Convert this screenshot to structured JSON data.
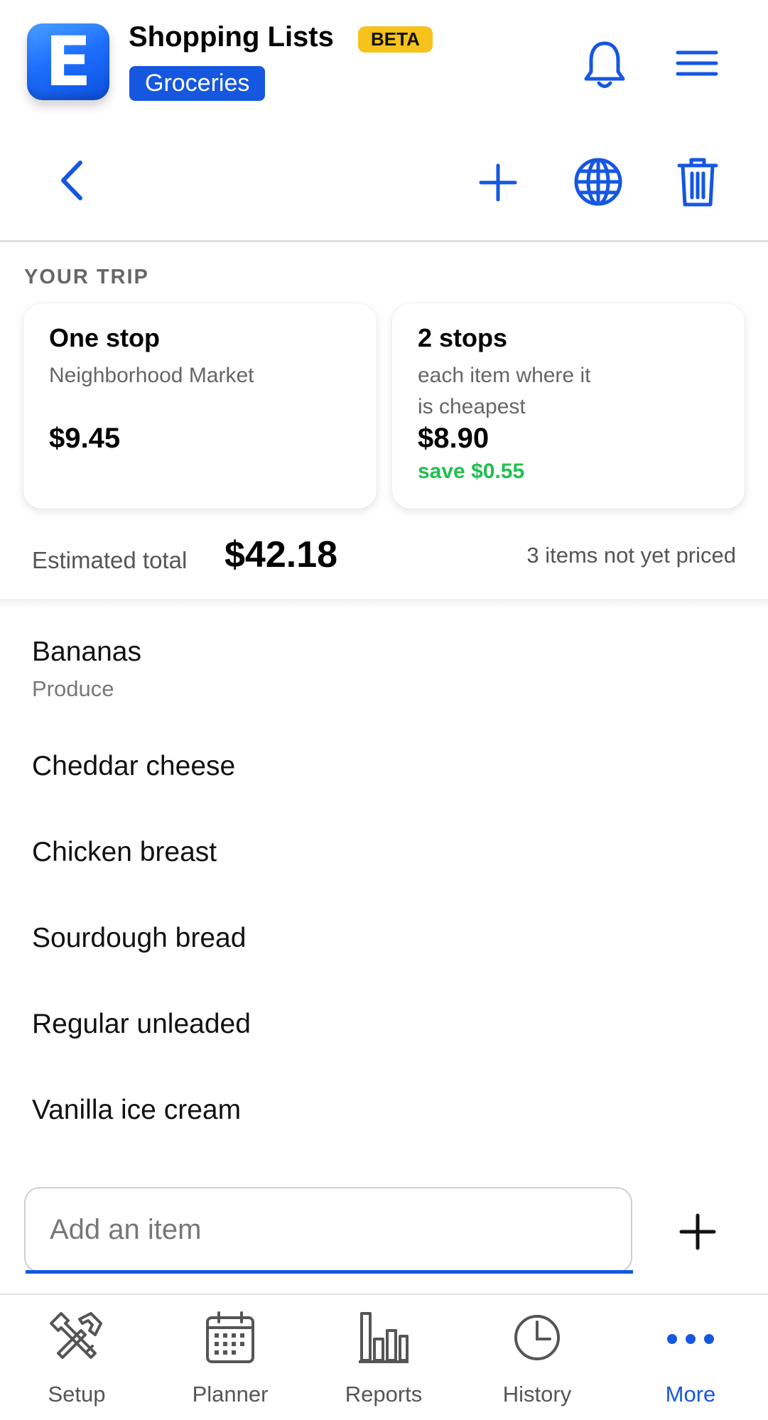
{
  "header": {
    "logo_letter": "E",
    "app_title": "Shopping Lists",
    "badge": "BETA",
    "list_name": "Groceries"
  },
  "toolbar": {
    "icons": [
      "back-icon",
      "add-icon",
      "globe-icon",
      "trash-icon"
    ]
  },
  "trip": {
    "section_label": "YOUR TRIP",
    "one_stop": {
      "title": "One stop",
      "subtitle": "Neighborhood Market",
      "price": "$9.45"
    },
    "two_stops": {
      "title": "2 stops",
      "subtitle_line1": "each item where it",
      "subtitle_line2": "is cheapest",
      "price": "$8.90",
      "savings": "save $0.55"
    },
    "estimated_label": "Estimated total",
    "estimated_value": "$42.18",
    "unpriced_note": "3 items not yet priced"
  },
  "items": [
    {
      "name": "Bananas",
      "category": "Produce"
    },
    {
      "name": "Cheddar cheese"
    },
    {
      "name": "Chicken breast"
    },
    {
      "name": "Sourdough bread"
    },
    {
      "name": "Regular unleaded"
    },
    {
      "name": "Vanilla ice cream"
    }
  ],
  "add_item": {
    "placeholder": "Add an item"
  },
  "tabs": [
    {
      "label": "Setup",
      "icon": "tools-icon"
    },
    {
      "label": "Planner",
      "icon": "calendar-icon"
    },
    {
      "label": "Reports",
      "icon": "bar-chart-icon"
    },
    {
      "label": "History",
      "icon": "clock-icon"
    },
    {
      "label": "More",
      "icon": "more-icon",
      "active": true
    }
  ],
  "colors": {
    "accent": "#1657e0",
    "badge": "#f6c21b",
    "savings": "#21c04f"
  }
}
